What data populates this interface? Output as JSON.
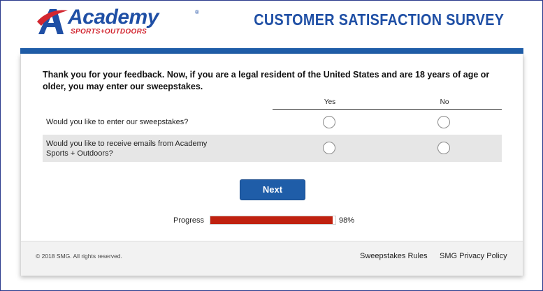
{
  "brand": {
    "name": "Academy",
    "tagline": "SPORTS+OUTDOORS",
    "registered_mark": "®",
    "colors": {
      "blue": "#1f4fa5",
      "red": "#d22630"
    }
  },
  "survey_title": "CUSTOMER SATISFACTION SURVEY",
  "intro_text": "Thank you for your feedback. Now, if you are a legal resident of the United States and are 18 years of age or older, you may enter our sweepstakes.",
  "columns": {
    "yes": "Yes",
    "no": "No"
  },
  "questions": [
    {
      "text": "Would you like to enter our sweepstakes?",
      "selected": null
    },
    {
      "text": "Would you like to receive emails from Academy Sports + Outdoors?",
      "selected": null
    }
  ],
  "next_button": "Next",
  "progress": {
    "label": "Progress",
    "percent": 98,
    "display": "98%",
    "fill_color": "#c0210f"
  },
  "footer": {
    "copyright": "© 2018 SMG. All rights reserved.",
    "links": [
      "Sweepstakes Rules",
      "SMG Privacy Policy"
    ]
  }
}
